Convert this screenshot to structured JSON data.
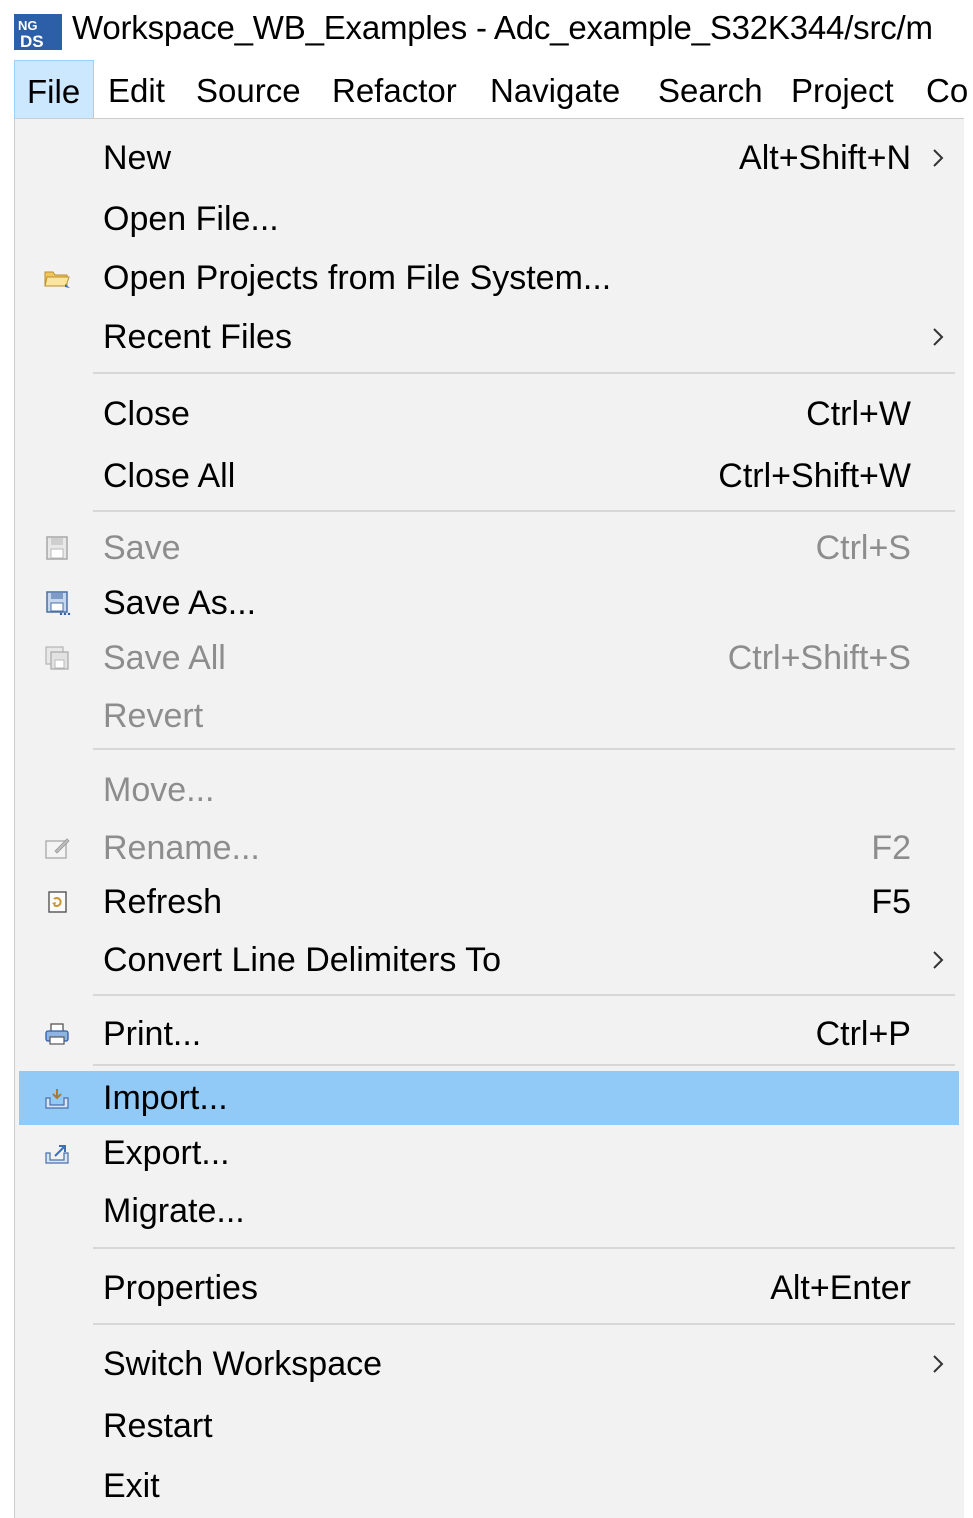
{
  "window": {
    "title": "Workspace_WB_Examples - Adc_example_S32K344/src/m",
    "app_icon": "ds-app-icon"
  },
  "menubar": {
    "items": [
      {
        "label": "File",
        "active": true
      },
      {
        "label": "Edit"
      },
      {
        "label": "Source"
      },
      {
        "label": "Refactor"
      },
      {
        "label": "Navigate"
      },
      {
        "label": "Search"
      },
      {
        "label": "Project"
      },
      {
        "label": "Co"
      }
    ]
  },
  "file_menu": {
    "items": [
      {
        "label": "New",
        "shortcut": "Alt+Shift+N",
        "submenu": true
      },
      {
        "label": "Open File..."
      },
      {
        "label": "Open Projects from File System...",
        "icon": "folder-icon"
      },
      {
        "label": "Recent Files",
        "submenu": true
      },
      {
        "label": "Close",
        "shortcut": "Ctrl+W"
      },
      {
        "label": "Close All",
        "shortcut": "Ctrl+Shift+W"
      },
      {
        "label": "Save",
        "shortcut": "Ctrl+S",
        "disabled": true,
        "icon": "save-icon"
      },
      {
        "label": "Save As...",
        "icon": "save-as-icon"
      },
      {
        "label": "Save All",
        "shortcut": "Ctrl+Shift+S",
        "disabled": true,
        "icon": "save-all-icon"
      },
      {
        "label": "Revert",
        "disabled": true
      },
      {
        "label": "Move...",
        "disabled": true
      },
      {
        "label": "Rename...",
        "shortcut": "F2",
        "disabled": true,
        "icon": "rename-icon"
      },
      {
        "label": "Refresh",
        "shortcut": "F5",
        "icon": "refresh-icon"
      },
      {
        "label": "Convert Line Delimiters To",
        "submenu": true
      },
      {
        "label": "Print...",
        "shortcut": "Ctrl+P",
        "icon": "print-icon"
      },
      {
        "label": "Import...",
        "highlighted": true,
        "icon": "import-icon"
      },
      {
        "label": "Export...",
        "icon": "export-icon"
      },
      {
        "label": "Migrate..."
      },
      {
        "label": "Properties",
        "shortcut": "Alt+Enter"
      },
      {
        "label": "Switch Workspace",
        "submenu": true
      },
      {
        "label": "Restart"
      },
      {
        "label": "Exit"
      }
    ]
  }
}
